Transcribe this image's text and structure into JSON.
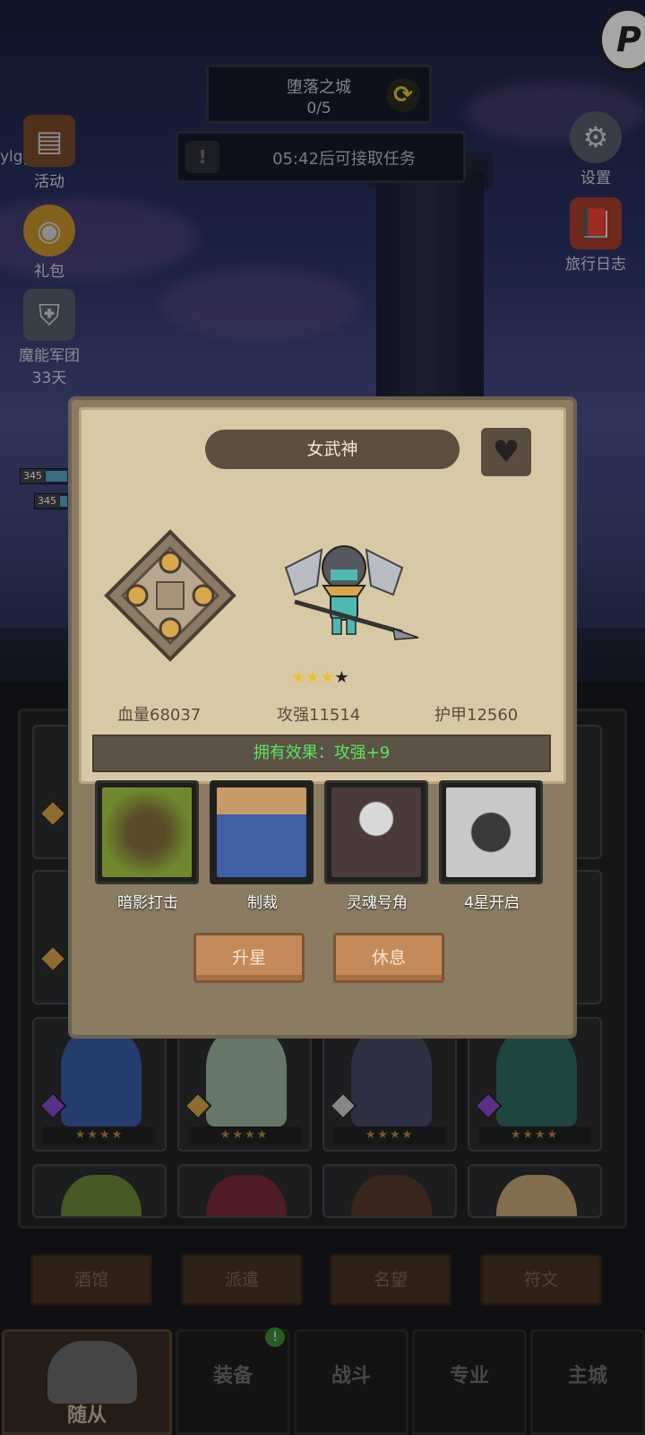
{
  "hud": {
    "stage_name": "堕落之城",
    "stage_progress": "0/5",
    "task_timer": "05:42后可接取任务",
    "username": "ylgyu",
    "corner_logo": "P"
  },
  "left_menu": [
    {
      "label": "活动",
      "icon": "scroll-icon",
      "color": "#7a4a2a"
    },
    {
      "label": "礼包",
      "icon": "coin-icon",
      "color": "#c8962a"
    },
    {
      "label": "魔能军团",
      "sublabel": "33天",
      "icon": "legion-crest-icon",
      "color": "#55606a"
    }
  ],
  "right_menu": [
    {
      "label": "设置",
      "icon": "gear-icon",
      "color": "#5a5e6a"
    },
    {
      "label": "旅行日志",
      "icon": "journal-icon",
      "color": "#a8402a"
    }
  ],
  "background_hpbars": [
    {
      "level": "345",
      "fill": 0.6
    },
    {
      "level": "345",
      "fill": 0.3
    }
  ],
  "modal": {
    "hero_name": "女武神",
    "favorite_icon": "heart-icon",
    "stars": {
      "filled": 3,
      "total": 4
    },
    "stats": {
      "hp": "血量68037",
      "attack": "攻强11514",
      "armor": "护甲12560"
    },
    "owned_effect": "拥有效果：攻强+9",
    "skills": [
      {
        "label": "暗影打击",
        "icon": "shadow-strike-icon",
        "color": "#6f8a2e"
      },
      {
        "label": "制裁",
        "icon": "hammer-icon",
        "color": "#3f5fa6"
      },
      {
        "label": "灵魂号角",
        "icon": "skull-horn-icon",
        "color": "#4b3a3a"
      },
      {
        "label": "4星开启",
        "icon": "locked-fist-icon",
        "color": "#8a8a8a"
      }
    ],
    "buttons": {
      "upgrade": "升星",
      "rest": "休息"
    }
  },
  "hero_grid": [
    {
      "diamond": "#d9a64a",
      "color": "#3a5ea8"
    },
    {
      "diamond": "#d9a64a",
      "color": "#9cb8a0"
    },
    {
      "diamond": "#cfcfcf",
      "color": "#4a4a6a"
    },
    {
      "diamond": "#8a4ad0",
      "color": "#2e6a62"
    }
  ],
  "hero_grid_stars": "★★★★",
  "sub_tabs": [
    "酒馆",
    "派遣",
    "名望",
    "符文"
  ],
  "main_tabs": [
    {
      "label": "随从",
      "active": true
    },
    {
      "label": "装备",
      "active": false,
      "badge": "!"
    },
    {
      "label": "战斗",
      "active": false
    },
    {
      "label": "专业",
      "active": false
    },
    {
      "label": "主城",
      "active": false
    }
  ]
}
